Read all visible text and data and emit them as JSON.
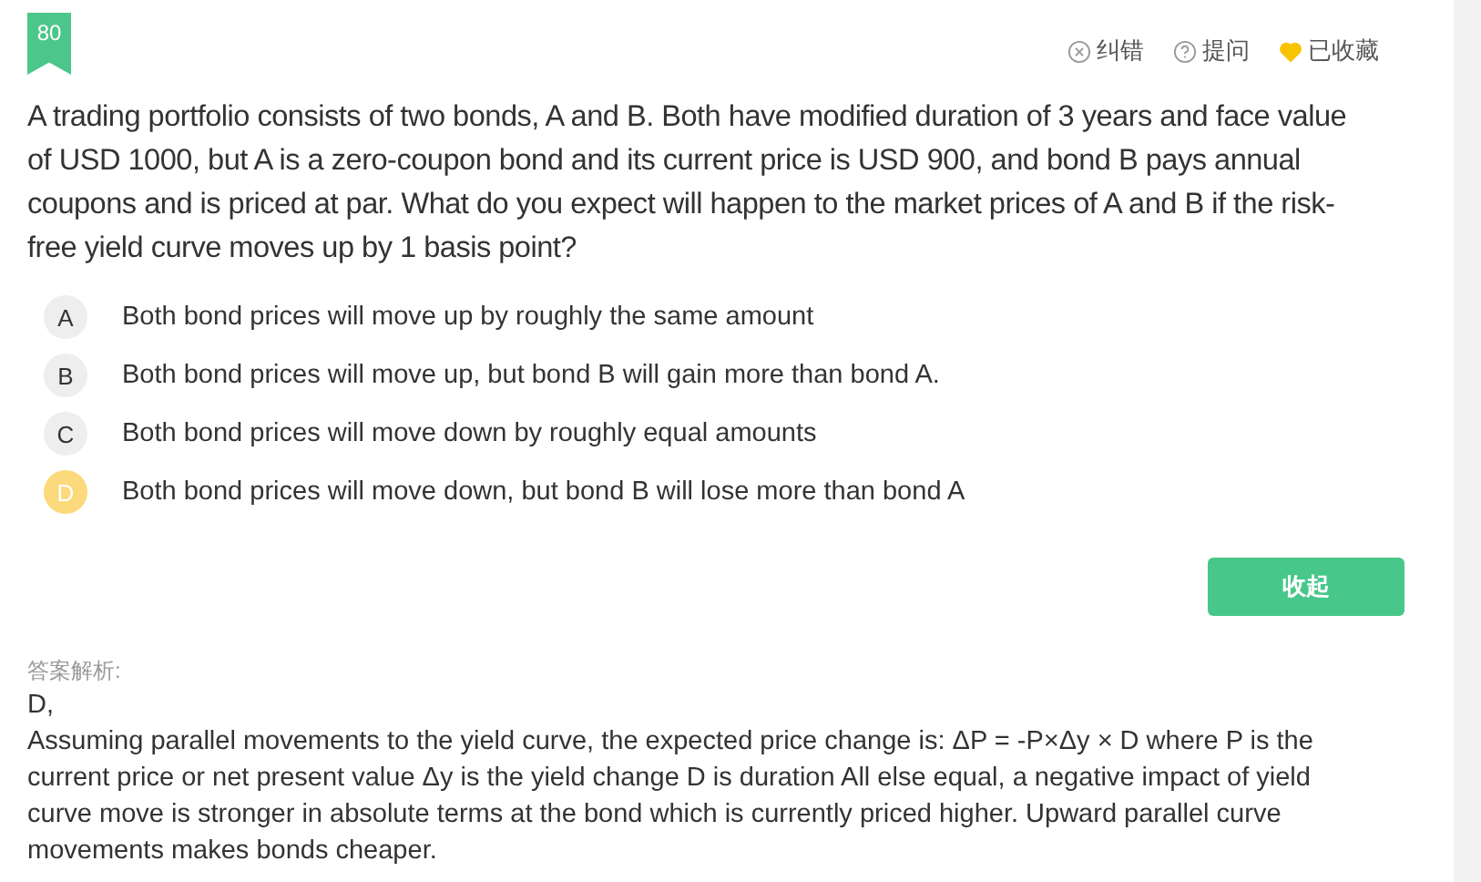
{
  "question_number": "80",
  "actions": [
    {
      "kind": "report",
      "label": "纠错"
    },
    {
      "kind": "ask",
      "label": "提问"
    },
    {
      "kind": "favorite",
      "label": "已收藏",
      "on": true
    }
  ],
  "question": "A trading portfolio consists of two bonds, A and B. Both have modified duration of 3 years and face value of USD 1000, but A is a zero-coupon bond and its current price is USD 900, and bond B pays annual coupons and is priced at par. What do you expect will happen to the market prices of A and B if the risk-free yield curve moves up by 1 basis point?",
  "options": [
    {
      "letter": "A",
      "text": "Both bond prices will move up by roughly the same amount",
      "selected": false
    },
    {
      "letter": "B",
      "text": "Both bond prices will move up, but bond B will gain more than bond A.",
      "selected": false
    },
    {
      "letter": "C",
      "text": "Both bond prices will move down by roughly equal amounts",
      "selected": false
    },
    {
      "letter": "D",
      "text": "Both bond prices will move down, but bond B will lose more than bond A",
      "selected": true
    }
  ],
  "collapse_button": "收起",
  "analysis": {
    "label": "答案解析:",
    "answer": "D,",
    "text": "Assuming parallel movements to the yield curve, the expected price change is: ΔP = -P×Δy × D where P is the current price or net present value Δy is the yield change D is duration All else equal, a negative impact of yield curve move is stronger in absolute terms at the bond which is currently priced higher. Upward parallel curve movements makes bonds cheaper."
  }
}
